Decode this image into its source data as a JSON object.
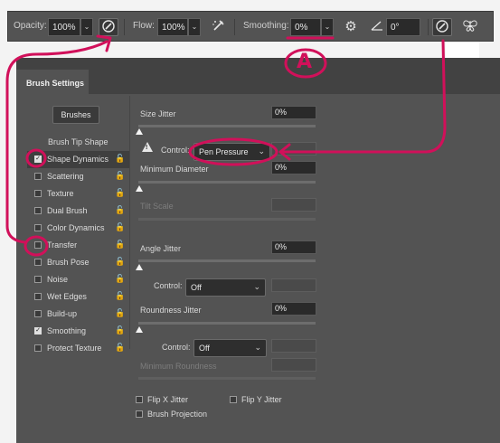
{
  "options_bar": {
    "opacity_label": "Opacity:",
    "opacity_value": "100%",
    "flow_label": "Flow:",
    "flow_value": "100%",
    "smoothing_label": "Smoothing:",
    "smoothing_value": "0%",
    "angle_value": "0°",
    "icons": [
      "pressure-opacity-icon",
      "airbrush-icon",
      "smoothing-gear-icon",
      "angle-icon",
      "pressure-size-icon",
      "symmetry-butterfly-icon"
    ]
  },
  "panel": {
    "tab_title": "Brush Settings",
    "brushes_button": "Brushes",
    "tip_shape_label": "Brush Tip Shape",
    "items": [
      {
        "label": "Shape Dynamics",
        "checked": true,
        "selected": true
      },
      {
        "label": "Scattering",
        "checked": false
      },
      {
        "label": "Texture",
        "checked": false
      },
      {
        "label": "Dual Brush",
        "checked": false
      },
      {
        "label": "Color Dynamics",
        "checked": false
      },
      {
        "label": "Transfer",
        "checked": false
      },
      {
        "label": "Brush Pose",
        "checked": false
      },
      {
        "label": "Noise",
        "checked": false
      },
      {
        "label": "Wet Edges",
        "checked": false
      },
      {
        "label": "Build-up",
        "checked": false
      },
      {
        "label": "Smoothing",
        "checked": true
      },
      {
        "label": "Protect Texture",
        "checked": false
      }
    ]
  },
  "settings": {
    "size_jitter_label": "Size Jitter",
    "size_jitter_value": "0%",
    "control_label": "Control:",
    "control_value": "Pen Pressure",
    "min_diameter_label": "Minimum Diameter",
    "min_diameter_value": "0%",
    "tilt_scale_label": "Tilt Scale",
    "angle_jitter_label": "Angle Jitter",
    "angle_jitter_value": "0%",
    "angle_control_label": "Control:",
    "angle_control_value": "Off",
    "roundness_jitter_label": "Roundness Jitter",
    "roundness_jitter_value": "0%",
    "roundness_control_label": "Control:",
    "roundness_control_value": "Off",
    "min_roundness_label": "Minimum Roundness",
    "flip_x_label": "Flip X Jitter",
    "flip_y_label": "Flip Y Jitter",
    "projection_label": "Brush Projection"
  },
  "annotation": {
    "letter": "A",
    "color": "#d1105a"
  },
  "colors": {
    "panel_bg": "#535353",
    "accent_annotation": "#d1105a"
  }
}
